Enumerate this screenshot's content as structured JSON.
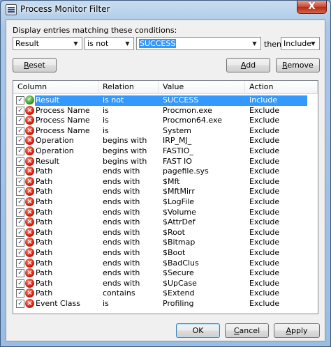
{
  "window": {
    "title": "Process Monitor Filter",
    "close_symbol": "X"
  },
  "filter": {
    "label": "Display entries matching these conditions:",
    "column_value": "Result",
    "relation_value": "is not",
    "value_text": "SUCCESS",
    "then_label": "then",
    "action_value": "Include"
  },
  "buttons": {
    "reset": {
      "pre": "",
      "ul": "R",
      "post": "eset"
    },
    "add": {
      "pre": "",
      "ul": "A",
      "post": "dd"
    },
    "remove": {
      "pre": "",
      "ul": "R",
      "post": "emove"
    },
    "ok": "OK",
    "cancel": {
      "pre": "",
      "ul": "C",
      "post": "ancel"
    },
    "apply": {
      "pre": "",
      "ul": "A",
      "post": "pply"
    }
  },
  "table": {
    "headers": [
      "Column",
      "Relation",
      "Value",
      "Action"
    ],
    "rows": [
      {
        "column": "Result",
        "relation": "is not",
        "value": "SUCCESS",
        "action": "Include",
        "type": "include",
        "selected": true
      },
      {
        "column": "Process Name",
        "relation": "is",
        "value": "Procmon.exe",
        "action": "Exclude",
        "type": "exclude"
      },
      {
        "column": "Process Name",
        "relation": "is",
        "value": "Procmon64.exe",
        "action": "Exclude",
        "type": "exclude"
      },
      {
        "column": "Process Name",
        "relation": "is",
        "value": "System",
        "action": "Exclude",
        "type": "exclude"
      },
      {
        "column": "Operation",
        "relation": "begins with",
        "value": "IRP_MJ_",
        "action": "Exclude",
        "type": "exclude"
      },
      {
        "column": "Operation",
        "relation": "begins with",
        "value": "FASTIO_",
        "action": "Exclude",
        "type": "exclude"
      },
      {
        "column": "Result",
        "relation": "begins with",
        "value": "FAST IO",
        "action": "Exclude",
        "type": "exclude"
      },
      {
        "column": "Path",
        "relation": "ends with",
        "value": "pagefile.sys",
        "action": "Exclude",
        "type": "exclude"
      },
      {
        "column": "Path",
        "relation": "ends with",
        "value": "$Mft",
        "action": "Exclude",
        "type": "exclude"
      },
      {
        "column": "Path",
        "relation": "ends with",
        "value": "$MftMirr",
        "action": "Exclude",
        "type": "exclude"
      },
      {
        "column": "Path",
        "relation": "ends with",
        "value": "$LogFile",
        "action": "Exclude",
        "type": "exclude"
      },
      {
        "column": "Path",
        "relation": "ends with",
        "value": "$Volume",
        "action": "Exclude",
        "type": "exclude"
      },
      {
        "column": "Path",
        "relation": "ends with",
        "value": "$AttrDef",
        "action": "Exclude",
        "type": "exclude"
      },
      {
        "column": "Path",
        "relation": "ends with",
        "value": "$Root",
        "action": "Exclude",
        "type": "exclude"
      },
      {
        "column": "Path",
        "relation": "ends with",
        "value": "$Bitmap",
        "action": "Exclude",
        "type": "exclude"
      },
      {
        "column": "Path",
        "relation": "ends with",
        "value": "$Boot",
        "action": "Exclude",
        "type": "exclude"
      },
      {
        "column": "Path",
        "relation": "ends with",
        "value": "$BadClus",
        "action": "Exclude",
        "type": "exclude"
      },
      {
        "column": "Path",
        "relation": "ends with",
        "value": "$Secure",
        "action": "Exclude",
        "type": "exclude"
      },
      {
        "column": "Path",
        "relation": "ends with",
        "value": "$UpCase",
        "action": "Exclude",
        "type": "exclude"
      },
      {
        "column": "Path",
        "relation": "contains",
        "value": "$Extend",
        "action": "Exclude",
        "type": "exclude"
      },
      {
        "column": "Event Class",
        "relation": "is",
        "value": "Profiling",
        "action": "Exclude",
        "type": "exclude"
      }
    ]
  },
  "colors": {
    "selection": "#3399ff",
    "exclude_icon": "#d21d0c",
    "include_icon": "#3c9a2e"
  },
  "icons": {
    "checkbox_check": "✓",
    "exclude_glyph": "×",
    "include_glyph": "✓"
  }
}
